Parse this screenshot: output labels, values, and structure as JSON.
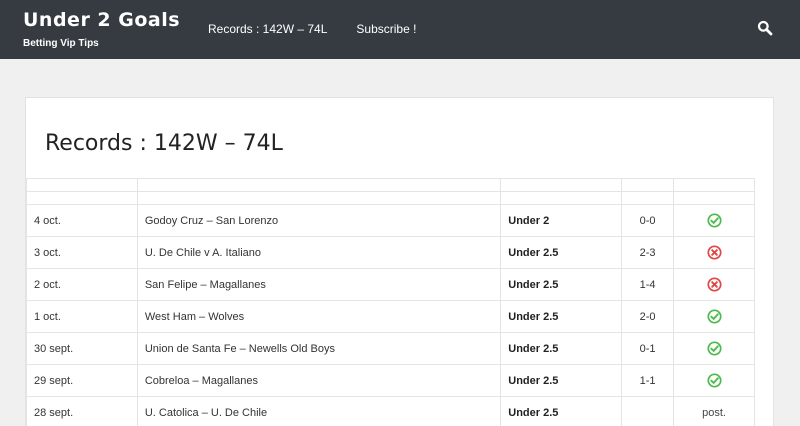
{
  "header": {
    "site_title": "Under 2 Goals",
    "tagline": "Betting Vip Tips",
    "nav": [
      {
        "label": "Records : 142W – 74L"
      },
      {
        "label": "Subscribe !"
      }
    ]
  },
  "page": {
    "title": "Records : 142W – 74L"
  },
  "colors": {
    "win": "#4cbb4c",
    "loss": "#e14545",
    "header_bg": "#353b41"
  },
  "records": [
    {
      "date": "4 oct.",
      "match": "Godoy Cruz – San Lorenzo",
      "pick": "Under 2",
      "score": "0-0",
      "result": "win"
    },
    {
      "date": "3 oct.",
      "match": "U. De Chile v  A. Italiano",
      "pick": "Under 2.5",
      "score": "2-3",
      "result": "loss"
    },
    {
      "date": "2 oct.",
      "match": "San Felipe – Magallanes",
      "pick": "Under 2.5",
      "score": "1-4",
      "result": "loss"
    },
    {
      "date": "1 oct.",
      "match": " West Ham – Wolves",
      "pick": "Under 2.5",
      "score": "2-0",
      "result": "win"
    },
    {
      "date": "30 sept.",
      "match": "Union de Santa Fe – Newells Old Boys",
      "pick": "Under 2.5",
      "score": "0-1",
      "result": "win"
    },
    {
      "date": "29 sept.",
      "match": "Cobreloa – Magallanes",
      "pick": "Under 2.5",
      "score": "1-1",
      "result": "win"
    },
    {
      "date": "28 sept.",
      "match": "U. Catolica – U. De Chile",
      "pick": "Under 2.5",
      "score": "",
      "result": "post.",
      "result_text": "post."
    }
  ]
}
